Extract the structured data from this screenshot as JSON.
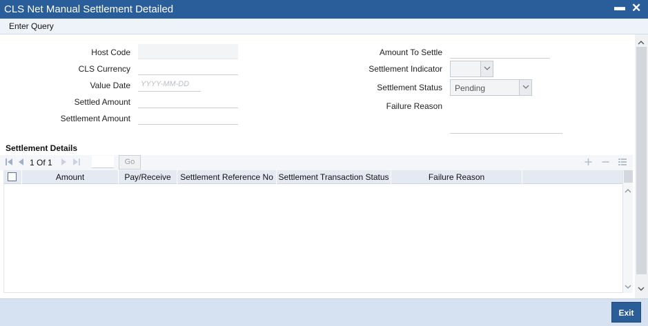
{
  "window": {
    "title": "CLS Net Manual Settlement Detailed",
    "minimize_glyph": "▬",
    "close_glyph": "✕"
  },
  "menu": {
    "enter_query": "Enter Query"
  },
  "form": {
    "host_code_label": "Host Code",
    "host_code_value": "",
    "cls_currency_label": "CLS Currency",
    "cls_currency_value": "",
    "value_date_label": "Value Date",
    "value_date_placeholder": "YYYY-MM-DD",
    "settled_amount_label": "Settled Amount",
    "settled_amount_value": "",
    "settlement_amount_label": "Settlement Amount",
    "settlement_amount_value": "",
    "amount_to_settle_label": "Amount To Settle",
    "amount_to_settle_value": "",
    "settlement_indicator_label": "Settlement Indicator",
    "settlement_indicator_value": "",
    "settlement_status_label": "Settlement Status",
    "settlement_status_value": "Pending",
    "failure_reason_label": "Failure Reason",
    "failure_reason_value": ""
  },
  "settlement_details": {
    "title": "Settlement Details",
    "pagination": {
      "current": "1",
      "of_label": "Of",
      "total": "1",
      "go_label": "Go"
    },
    "columns": [
      "Amount",
      "Pay/Receive",
      "Settlement Reference No",
      "Settlement Transaction Status",
      "Failure Reason"
    ],
    "rows": []
  },
  "footer": {
    "exit_label": "Exit"
  },
  "colors": {
    "titlebar": "#2a5e9a",
    "menubar": "#eef2f9",
    "grid_header": "#e4e9f2",
    "footer": "#d6e1f1",
    "exit_button": "#2b5d98"
  },
  "icons": {
    "first_page": "first-page-icon",
    "prev_page": "prev-page-icon",
    "next_page": "next-page-icon",
    "last_page": "last-page-icon",
    "add_row": "plus-icon",
    "delete_row": "minus-icon",
    "single_view": "list-view-icon"
  }
}
